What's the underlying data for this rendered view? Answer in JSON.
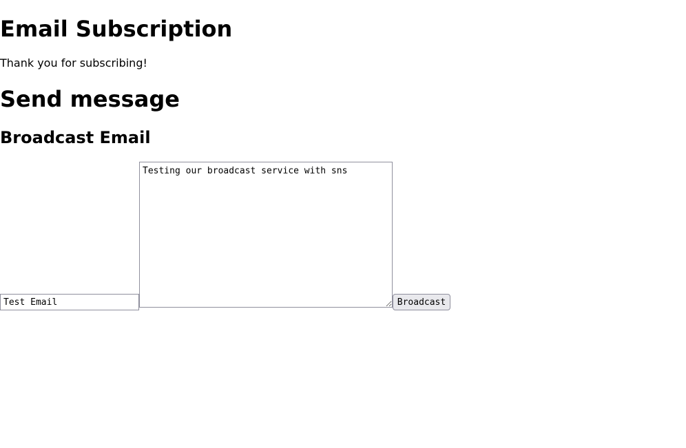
{
  "page": {
    "title": "Email Subscription",
    "thanks_message": "Thank you for subscribing!"
  },
  "send_section": {
    "title": "Send message"
  },
  "broadcast_form": {
    "title": "Broadcast Email",
    "subject_value": "Test Email",
    "message_value": "Testing our broadcast service with sns",
    "button_label": "Broadcast"
  }
}
